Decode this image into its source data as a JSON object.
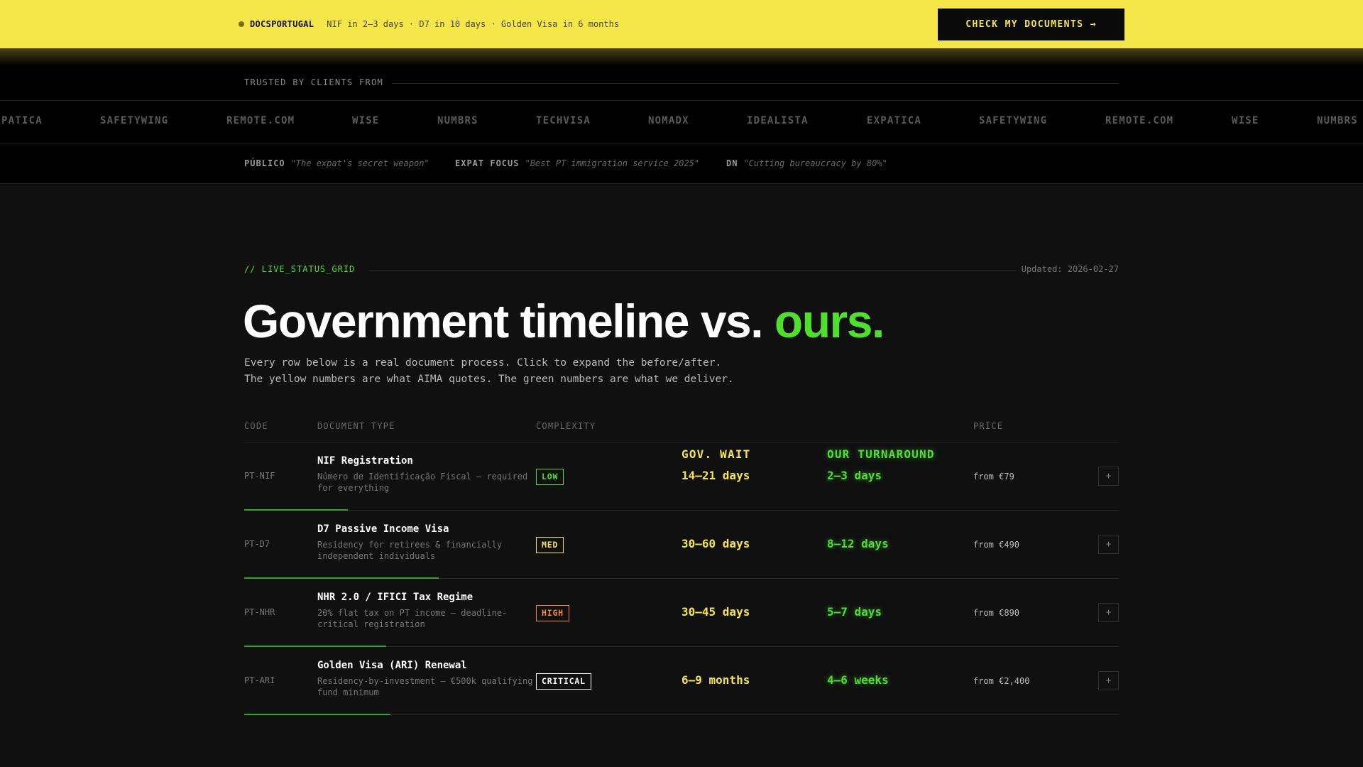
{
  "banner": {
    "brand": "DOCSPORTUGAL",
    "tagline": "NIF in 2–3 days · D7 in 10 days · Golden Visa in 6 months",
    "cta": "CHECK MY DOCUMENTS →"
  },
  "trusted": {
    "label": "TRUSTED BY CLIENTS FROM",
    "logos": [
      "PATICA",
      "SAFETYWING",
      "REMOTE.COM",
      "WISE",
      "NUMBRS",
      "TECHVISA",
      "NOMADX",
      "IDEALISTA",
      "EXPATICA",
      "SAFETYWING",
      "REMOTE.COM",
      "WISE",
      "NUMBRS"
    ]
  },
  "press": [
    {
      "source": "PÚBLICO",
      "quote": "\"The expat's secret weapon\""
    },
    {
      "source": "EXPAT FOCUS",
      "quote": "\"Best PT immigration service 2025\""
    },
    {
      "source": "DN",
      "quote": "\"Cutting bureaucracy by 80%\""
    }
  ],
  "section": {
    "kicker": "// LIVE_STATUS_GRID",
    "updated": "Updated: 2026-02-27",
    "headline_main": "Government timeline vs. ",
    "headline_accent": "ours.",
    "sub_line1": "Every row below is a real document process. Click to expand the before/after.",
    "sub_line2": "The yellow numbers are what AIMA quotes. The green numbers are what we deliver."
  },
  "table": {
    "headers": {
      "code": "CODE",
      "doc": "DOCUMENT TYPE",
      "complexity": "COMPLEXITY",
      "gov": "GOV. WAIT",
      "ours": "OUR TURNAROUND",
      "price": "PRICE"
    },
    "rows": [
      {
        "code": "PT-NIF",
        "name": "NIF Registration",
        "desc": "Número de Identificação Fiscal — required for everything",
        "complexity": "LOW",
        "gov": "14–21 days",
        "ours": "2–3 days",
        "price": "from €79",
        "expand": "+"
      },
      {
        "code": "PT-D7",
        "name": "D7 Passive Income Visa",
        "desc": "Residency for retirees & financially independent individuals",
        "complexity": "MED",
        "gov": "30–60 days",
        "ours": "8–12 days",
        "price": "from €490",
        "expand": "+"
      },
      {
        "code": "PT-NHR",
        "name": "NHR 2.0 / IFICI Tax Regime",
        "desc": "20% flat tax on PT income — deadline-critical registration",
        "complexity": "HIGH",
        "gov": "30–45 days",
        "ours": "5–7 days",
        "price": "from €890",
        "expand": "+"
      },
      {
        "code": "PT-ARI",
        "name": "Golden Visa (ARI) Renewal",
        "desc": "Residency-by-investment — €500k qualifying fund minimum",
        "complexity": "CRITICAL",
        "gov": "6–9 months",
        "ours": "4–6 weeks",
        "price": "from €2,400",
        "expand": "+"
      }
    ]
  },
  "colors": {
    "banner": "#f5e64a",
    "accent_green": "#4ee02c",
    "low": "#4ee02c",
    "med": "#f5e64a",
    "high": "#f08a3a",
    "critical": "#ffffff"
  }
}
